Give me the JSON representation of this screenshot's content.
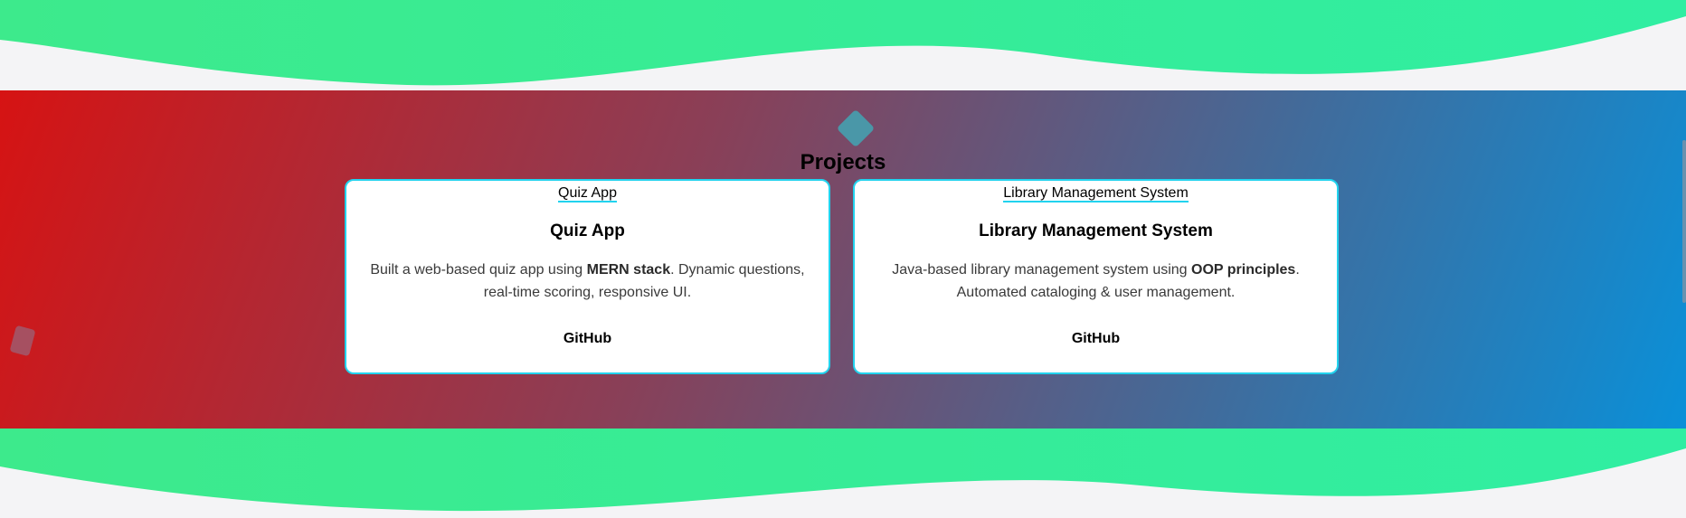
{
  "colors": {
    "wave": "#34ee96",
    "background": "#f4f4f6",
    "gradient_start": "#d61313",
    "gradient_end": "#0a90d8",
    "card_border": "#22d3ee",
    "diamond": "#4a97a8"
  },
  "icons": {
    "top_decor": "diamond-icon",
    "side_decor": "rounded-rect-icon"
  },
  "section": {
    "title": "Projects"
  },
  "projects": [
    {
      "link_label": "Quiz App",
      "title": "Quiz App",
      "desc_before": "Built a web-based quiz app using ",
      "desc_bold": "MERN stack",
      "desc_after": ". Dynamic questions, real-time scoring, responsive UI.",
      "github_label": "GitHub"
    },
    {
      "link_label": "Library Management System",
      "title": "Library Management System",
      "desc_before": "Java-based library management system using ",
      "desc_bold": "OOP principles",
      "desc_after": ". Automated cataloging & user management.",
      "github_label": "GitHub"
    }
  ]
}
